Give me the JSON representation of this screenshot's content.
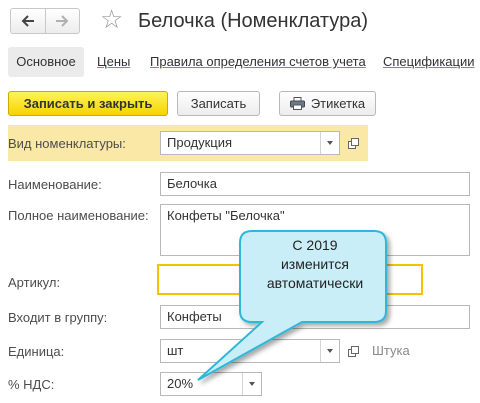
{
  "header": {
    "title": "Белочка (Номенклатура)",
    "back_icon": "arrow-left-icon",
    "forward_icon": "arrow-right-icon",
    "favorite_icon": "star-icon"
  },
  "tabs": [
    {
      "label": "Основное",
      "active": true
    },
    {
      "label": "Цены"
    },
    {
      "label": "Правила определения счетов учета"
    },
    {
      "label": "Спецификации"
    }
  ],
  "toolbar": {
    "save_close_label": "Записать и закрыть",
    "save_label": "Записать",
    "label_button_label": "Этикетка",
    "label_button_icon": "printer-icon"
  },
  "form": {
    "kind": {
      "label": "Вид номенклатуры:",
      "value": "Продукция"
    },
    "name": {
      "label": "Наименование:",
      "value": "Белочка"
    },
    "full_name": {
      "label": "Полное наименование:",
      "value": "Конфеты \"Белочка\""
    },
    "article": {
      "label": "Артикул:",
      "value": ""
    },
    "group": {
      "label": "Входит в группу:",
      "value": "Конфеты"
    },
    "unit": {
      "label": "Единица:",
      "value": "шт",
      "hint": "Штука"
    },
    "vat": {
      "label": "% НДС:",
      "value": "20%"
    }
  },
  "callout": {
    "lines": [
      "С 2019",
      "изменится",
      "автоматически"
    ]
  },
  "colors": {
    "accent_yellow": "#f6d400",
    "highlight_row": "#f9e8a6",
    "callout_fill": "#c9eef8",
    "callout_border": "#2fb7d8",
    "article_border": "#f0c400"
  }
}
